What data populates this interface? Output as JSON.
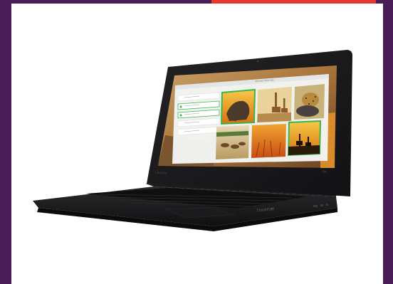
{
  "colors": {
    "background": "#4a1d57",
    "accent": "#e8372c",
    "frame": "#ffffff",
    "laptop_body": "#1a1a1c",
    "screen_app_panel": "#f4f6f6",
    "selection_green": "#3ab54a"
  },
  "laptop": {
    "screen_brand": "Lenovo",
    "model_badge": "11e",
    "deck_brand": "ThinkPad"
  },
  "screen": {
    "window_title": "Windows Photo App"
  }
}
